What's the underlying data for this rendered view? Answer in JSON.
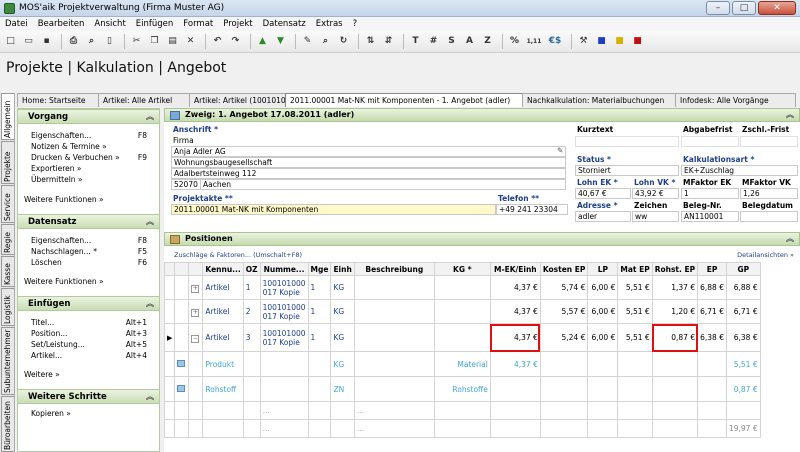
{
  "window": {
    "title": "MOS'aik Projektverwaltung (Firma Muster AG)",
    "minimize": "–",
    "maximize": "□",
    "close": "✕"
  },
  "menu": [
    "Datei",
    "Bearbeiten",
    "Ansicht",
    "Einfügen",
    "Format",
    "Projekt",
    "Datensatz",
    "Extras",
    "?"
  ],
  "toolbar": {
    "icons": [
      "new-icon",
      "open-icon",
      "save-icon",
      "print-icon",
      "print-preview-icon",
      "page-icon",
      "cut-icon",
      "copy-icon",
      "paste-icon",
      "delete-icon",
      "undo-icon",
      "redo-icon",
      "up-icon",
      "down-icon",
      "edit-icon",
      "search-icon",
      "refresh-icon",
      "sort-icon",
      "sort-desc-icon"
    ],
    "text_buttons": [
      "T",
      "#",
      "S",
      "A",
      "Z",
      "%",
      "1,11",
      "€$"
    ]
  },
  "page_title": "Projekte | Kalkulation | Angebot",
  "vertical_tabs": [
    "Allgemein",
    "Projekte",
    "Service",
    "Regie",
    "Kasse",
    "Logistik",
    "Subunternehmer",
    "Büroarbeiten"
  ],
  "tabs": [
    "Home: Startseite",
    "Artikel: Alle Artikel",
    "Artikel: Artikel (100101000...",
    "2011.00001 Mat-NK mit Komponenten - 1. Angebot (adler)",
    "Nachkalkulation: Materialbuchungen",
    "Infodesk: Alle Vorgänge"
  ],
  "left": {
    "sections": [
      {
        "title": "Vorgang",
        "items": [
          {
            "label": "Eigenschaften...",
            "shortcut": "F8"
          },
          {
            "label": "Notizen & Termine »",
            "shortcut": ""
          },
          {
            "label": "Drucken & Verbuchen »",
            "shortcut": "F9"
          },
          {
            "label": "Exportieren »",
            "shortcut": ""
          },
          {
            "label": "Übermitteln »",
            "shortcut": ""
          }
        ],
        "more": "Weitere Funktionen »"
      },
      {
        "title": "Datensatz",
        "items": [
          {
            "label": "Eigenschaften...",
            "shortcut": "F8"
          },
          {
            "label": "Nachschlagen... *",
            "shortcut": "F5"
          },
          {
            "label": "Löschen",
            "shortcut": "F6"
          }
        ],
        "more": "Weitere Funktionen »"
      },
      {
        "title": "Einfügen",
        "items": [
          {
            "label": "Titel...",
            "shortcut": "Alt+1"
          },
          {
            "label": "Position...",
            "shortcut": "Alt+3"
          },
          {
            "label": "Set/Leistung...",
            "shortcut": "Alt+5"
          },
          {
            "label": "Artikel...",
            "shortcut": "Alt+4"
          }
        ],
        "more": "Weitere »"
      },
      {
        "title": "Weitere Schritte",
        "items": [
          {
            "label": "Kopieren »",
            "shortcut": ""
          }
        ],
        "more": ""
      }
    ]
  },
  "zweig": {
    "title": "Zweig: 1. Angebot 17.08.2011 (adler)",
    "anschrift_label": "Anschrift *",
    "address_lines": [
      "Firma",
      "Anja Adler AG",
      "Wohnungsbaugesellschaft",
      "Adalbertsteinweg 112"
    ],
    "plz": "52070",
    "ort": "Aachen",
    "projektakte_label": "Projektakte **",
    "projektakte": "2011.00001 Mat-NK mit Komponenten",
    "telefon_label": "Telefon **",
    "telefon": "+49 241 23304",
    "kurztext_label": "Kurztext",
    "abgabefrist_label": "Abgabefrist",
    "zschl_frist_label": "Zschl.-Frist",
    "status_label": "Status *",
    "status": "Storniert",
    "kalkulationsart_label": "Kalkulationsart *",
    "kalkulationsart": "EK+Zuschlag",
    "lohn_ek_label": "Lohn EK *",
    "lohn_ek": "40,67 €",
    "lohn_vk_label": "Lohn VK *",
    "lohn_vk": "43,92 €",
    "mfaktor_ek_label": "MFaktor EK",
    "mfaktor_ek": "1",
    "mfaktor_vk_label": "MFaktor VK",
    "mfaktor_vk": "1,26",
    "adresse_label": "Adresse *",
    "adresse": "adler",
    "zeichen_label": "Zeichen",
    "zeichen": "ww",
    "belegnr_label": "Beleg-Nr.",
    "belegnr": "AN110001",
    "belegdatum_label": "Belegdatum",
    "belegdatum": ""
  },
  "positionen": {
    "title": "Positionen",
    "zuschlaege_link": "Zuschläge & Faktoren... (Umschalt+F8)",
    "details_link": "Detailansichten »",
    "columns": [
      "Kennu...",
      "OZ",
      "Numme...",
      "Mge",
      "Einh",
      "Beschreibung",
      "KG *",
      "M-EK/Einh",
      "Kosten EP",
      "LP",
      "Mat EP",
      "Rohst. EP",
      "EP",
      "GP"
    ],
    "rows": [
      {
        "kennung": "Artikel",
        "oz": "1",
        "nummer": "100101000 017 Kopie",
        "mge": "1",
        "einh": "KG",
        "beschreibung": "",
        "kg": "",
        "mek": "4,37 €",
        "kosten": "5,74 €",
        "lp": "6,00 €",
        "mat": "5,51 €",
        "rohst": "1,37 €",
        "ep": "6,88 €",
        "gp": "6,88 €"
      },
      {
        "kennung": "Artikel",
        "oz": "2",
        "nummer": "100101000 017 Kopie",
        "mge": "1",
        "einh": "KG",
        "beschreibung": "",
        "kg": "",
        "mek": "4,37 €",
        "kosten": "5,57 €",
        "lp": "6,00 €",
        "mat": "5,51 €",
        "rohst": "1,20 €",
        "ep": "6,71 €",
        "gp": "6,71 €"
      },
      {
        "kennung": "Artikel",
        "oz": "3",
        "nummer": "100101000 017 Kopie",
        "mge": "1",
        "einh": "KG",
        "beschreibung": "",
        "kg": "",
        "mek": "4,37 €",
        "kosten": "5,24 €",
        "lp": "6,00 €",
        "mat": "5,51 €",
        "rohst": "0,87 €",
        "ep": "6,38 €",
        "gp": "6,38 €"
      }
    ],
    "sub_rows": [
      {
        "kennung": "Produkt",
        "einh": "KG",
        "kg": "Material",
        "mek": "4,37 €",
        "gp": "5,51 €"
      },
      {
        "kennung": "Rohstoff",
        "einh": "ZN",
        "kg": "Rohstoffe",
        "mek": "",
        "gp": "0,87 €"
      }
    ],
    "ellipsis": "...",
    "total": "19,97 €"
  },
  "colors": {
    "header_green": "#c9ddb5",
    "link_blue": "#1f3f8a",
    "highlight_red": "#e01010",
    "sub_blue": "#3fa6d6",
    "input_yellow": "#fff8c8"
  }
}
